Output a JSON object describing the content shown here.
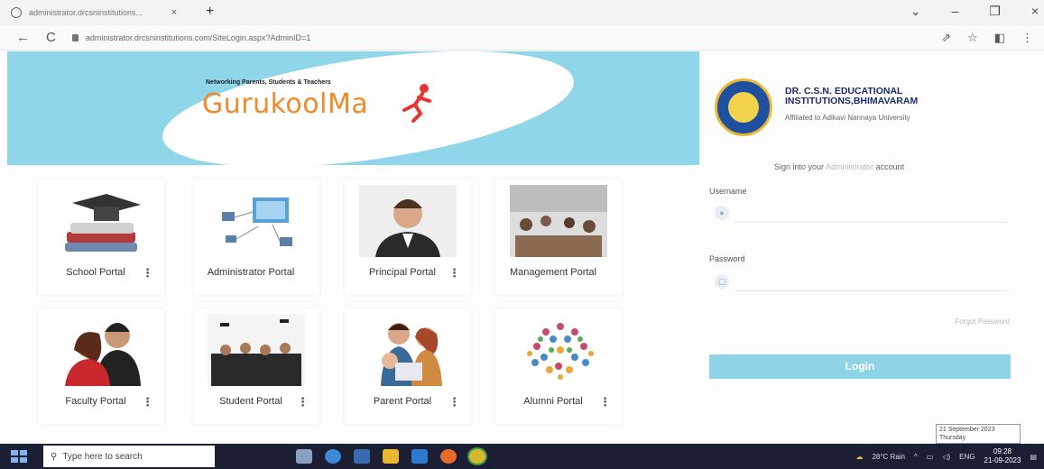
{
  "browser": {
    "tab_title": "administrator.drcsninstitutions...",
    "tab_close": "×",
    "new_tab": "+",
    "url": "administrator.drcsninstitutions.com/SiteLogin.aspx?AdminID=1",
    "back": "←",
    "reload": "C",
    "controls": [
      "⌄",
      "–",
      "❐",
      "×"
    ],
    "toolbar_icons": [
      "⇗",
      "☆",
      "◧",
      "⋮"
    ]
  },
  "banner": {
    "tagline": "Networking Parents, Students & Teachers",
    "brand": "GurukoolMa",
    "bg_color": "#8fd6ea",
    "brand_color": "#f08a2b"
  },
  "portals": [
    {
      "label": "School Portal",
      "icon": "books-graduation-cap"
    },
    {
      "label": "Administrator Portal",
      "icon": "network-computers"
    },
    {
      "label": "Principal Portal",
      "icon": "principal-photo"
    },
    {
      "label": "Management Portal",
      "icon": "meeting-photo"
    },
    {
      "label": "Faculty Portal",
      "icon": "faculty-people"
    },
    {
      "label": "Student Portal",
      "icon": "graduates-photo"
    },
    {
      "label": "Parent Portal",
      "icon": "family-photo"
    },
    {
      "label": "Alumni Portal",
      "icon": "alumni-network"
    }
  ],
  "login": {
    "institution_name_line1": "DR. C.S.N. EDUCATIONAL",
    "institution_name_line2": "INSTITUTIONS,BHIMAVARAM",
    "affiliation": "Affiliated to Adikavi Nannaya University",
    "signin_prefix": "Sign into your ",
    "signin_role": "Administrator",
    "signin_suffix": " account",
    "username_label": "Username",
    "password_label": "Password",
    "forgot": "Forgot Password",
    "login_button": "Login",
    "accent_color": "#8ed4e6"
  },
  "date_tooltip": {
    "date": "21 September 2023",
    "day": "Thursday"
  },
  "taskbar": {
    "search_placeholder": "Type here to search",
    "weather": "28°C Rain",
    "lang": "ENG",
    "time": "09:28",
    "date": "21-09-2023"
  }
}
